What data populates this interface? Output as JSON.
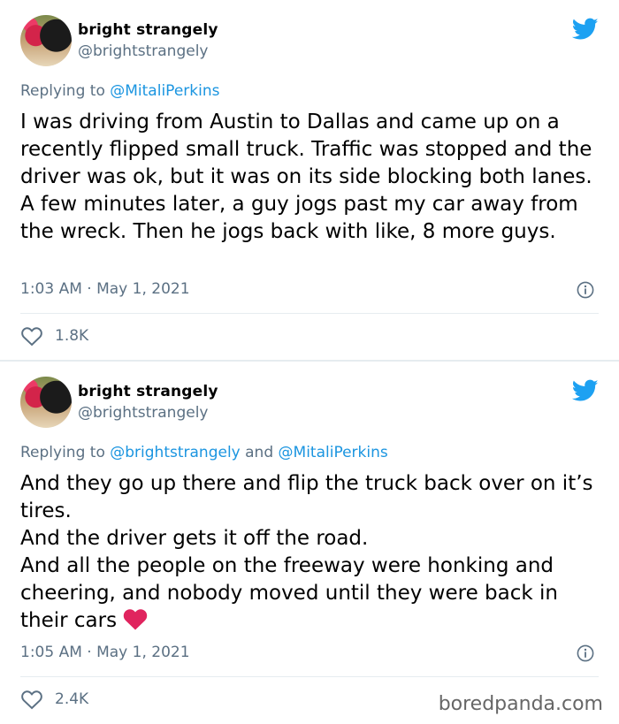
{
  "tweets": [
    {
      "display_name": "bright strangely",
      "handle": "@brightstrangely",
      "reply_prefix": "Replying to",
      "reply_mentions": "@MitaliPerkins",
      "text": "I was driving from Austin to Dallas and came up on a recently flipped small truck. Traffic was stopped and the driver was ok, but it was on its side blocking both lanes. A few minutes later, a guy jogs past my car away from the wreck. Then he jogs back with like, 8 more guys.",
      "timestamp": "1:03 AM · May 1, 2021",
      "likes": "1.8K"
    },
    {
      "display_name": "bright strangely",
      "handle": "@brightstrangely",
      "reply_prefix": "Replying to",
      "reply_mention_1": "@brightstrangely",
      "reply_and": "and",
      "reply_mention_2": "@MitaliPerkins",
      "text": "And they go up there and flip the truck back over on it’s tires.\nAnd the driver gets it off the road.\nAnd all the people on the freeway were honking and cheering, and nobody moved until they were back in their cars",
      "timestamp": "1:05 AM · May 1, 2021",
      "likes": "2.4K"
    }
  ],
  "watermark": "boredpanda.com",
  "colors": {
    "twitter_blue": "#1da1f2",
    "mention": "#1b95e0",
    "muted": "#5b7083",
    "heart_emoji": "#e0245e"
  },
  "icons": {
    "brand": "twitter-bird-icon",
    "info": "info-icon",
    "like": "heart-outline-icon",
    "emoji": "red-heart-emoji"
  }
}
